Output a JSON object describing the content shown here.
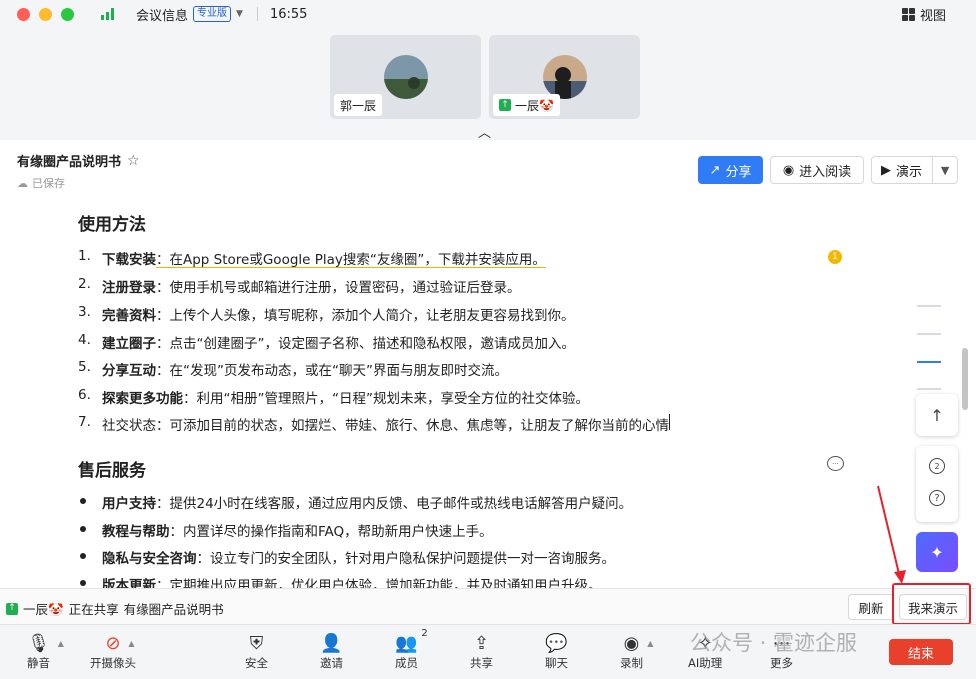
{
  "topbar": {
    "meeting_info": "会议信息",
    "badge": "专业版",
    "time": "16:55",
    "view": "视图"
  },
  "videos": [
    {
      "name": "郭一辰"
    },
    {
      "name": "一辰🤡"
    }
  ],
  "doc": {
    "title": "有缘圈产品说明书",
    "saved": "已保存",
    "share": "分享",
    "read": "进入阅读",
    "present": "演示"
  },
  "sections": [
    {
      "heading": "使用方法",
      "items": [
        {
          "marker": "1.",
          "bold": "下载安装",
          "text": "：在App Store或Google Play搜索“友缘圈”，下载并安装应用。"
        },
        {
          "marker": "2.",
          "bold": "注册登录",
          "text": "：使用手机号或邮箱进行注册，设置密码，通过验证后登录。"
        },
        {
          "marker": "3.",
          "bold": "完善资料",
          "text": "：上传个人头像，填写昵称，添加个人简介，让老朋友更容易找到你。"
        },
        {
          "marker": "4.",
          "bold": "建立圈子",
          "text": "：点击“创建圈子”，设定圈子名称、描述和隐私权限，邀请成员加入。"
        },
        {
          "marker": "5.",
          "bold": "分享互动",
          "text": "：在“发现”页发布动态，或在“聊天”界面与朋友即时交流。"
        },
        {
          "marker": "6.",
          "bold": "探索更多功能",
          "text": "：利用“相册”管理照片，“日程”规划未来，享受全方位的社交体验。"
        },
        {
          "marker": "7.",
          "bold": "",
          "text": "社交状态：可添加目前的状态，如摆烂、带娃、旅行、休息、焦虑等，让朋友了解你当前的心情"
        }
      ]
    },
    {
      "heading": "售后服务",
      "items": [
        {
          "bold": "用户支持",
          "text": "：提供24小时在线客服，通过应用内反馈、电子邮件或热线电话解答用户疑问。"
        },
        {
          "bold": "教程与帮助",
          "text": "：内置详尽的操作指南和FAQ，帮助新用户快速上手。"
        },
        {
          "bold": "隐私与安全咨询",
          "text": "：设立专门的安全团队，针对用户隐私保护问题提供一对一咨询服务。"
        },
        {
          "bold": "版本更新",
          "text": "：定期推出应用更新，优化用户体验，增加新功能，并及时通知用户升级。"
        }
      ]
    }
  ],
  "side": {
    "comment_count": "1",
    "group_count": "2"
  },
  "sharebar": {
    "sharer": "一辰🤡",
    "status": "正在共享",
    "doc_name": "有缘圈产品说明书",
    "refresh": "刷新",
    "me_present": "我来演示"
  },
  "toolbar": [
    {
      "key": "mute",
      "label": "静音"
    },
    {
      "key": "camera",
      "label": "开摄像头"
    },
    {
      "key": "security",
      "label": "安全"
    },
    {
      "key": "invite",
      "label": "邀请"
    },
    {
      "key": "members",
      "label": "成员",
      "count": "2"
    },
    {
      "key": "share",
      "label": "共享"
    },
    {
      "key": "chat",
      "label": "聊天"
    },
    {
      "key": "record",
      "label": "录制"
    },
    {
      "key": "ai",
      "label": "AI助理"
    },
    {
      "key": "more",
      "label": "更多"
    }
  ],
  "end_label": "结束",
  "watermark": "公众号 · 霍迹企服",
  "colors": {
    "accent": "#2f7cf6",
    "share_green": "#1fae52",
    "end_red": "#e8402a",
    "highlight_red": "#e8202a"
  }
}
